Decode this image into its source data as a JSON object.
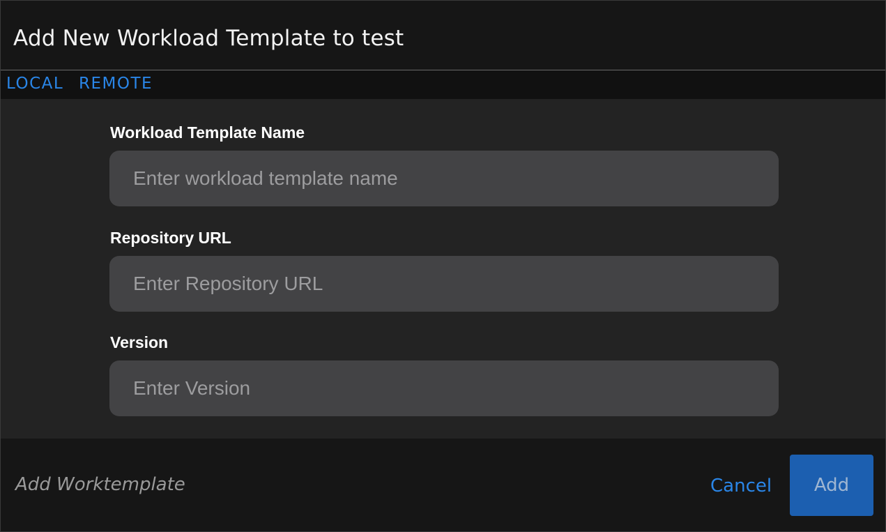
{
  "dialog": {
    "title": "Add New Workload Template to test"
  },
  "tabs": [
    {
      "label": "LOCAL",
      "active": false
    },
    {
      "label": "REMOTE",
      "active": true
    }
  ],
  "form": {
    "name": {
      "label": "Workload Template Name",
      "placeholder": "Enter workload template name",
      "value": ""
    },
    "repo_url": {
      "label": "Repository URL",
      "placeholder": "Enter Repository URL",
      "value": ""
    },
    "version": {
      "label": "Version",
      "placeholder": "Enter Version",
      "value": ""
    }
  },
  "footer": {
    "note": "Add Worktemplate",
    "cancel_label": "Cancel",
    "add_label": "Add"
  },
  "colors": {
    "accent": "#2a86e8",
    "add_button_bg": "#1c5fb0",
    "input_bg": "#434345",
    "body_bg": "#232323",
    "header_bg": "#161616"
  }
}
